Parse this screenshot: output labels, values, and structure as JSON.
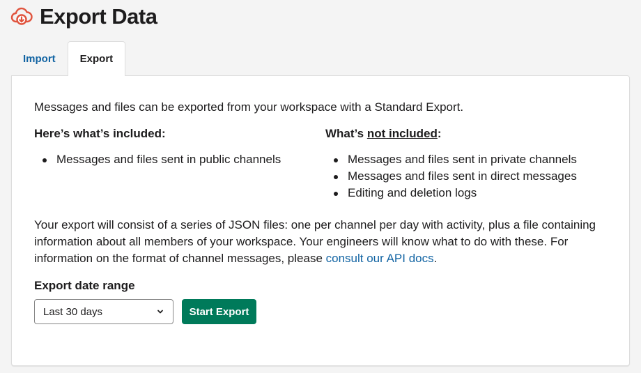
{
  "header": {
    "icon": "cloud-download-icon",
    "title": "Export Data",
    "icon_color": "#e0533d"
  },
  "tabs": [
    {
      "label": "Import",
      "active": false
    },
    {
      "label": "Export",
      "active": true
    }
  ],
  "panel": {
    "intro": "Messages and files can be exported from your workspace with a Standard Export.",
    "included": {
      "heading": "Here’s what’s included:",
      "items": [
        "Messages and files sent in public channels"
      ]
    },
    "not_included": {
      "heading_prefix": "What’s ",
      "heading_underlined": "not included",
      "heading_suffix": ":",
      "items": [
        "Messages and files sent in private channels",
        "Messages and files sent in direct messages",
        "Editing and deletion logs"
      ]
    },
    "description": "Your export will consist of a series of JSON files: one per channel per day with activity, plus a file containing information about all members of your workspace. Your engineers will know what to do with these. For information on the format of channel messages, please ",
    "description_link": "consult our API docs",
    "description_end": ".",
    "range_label": "Export date range",
    "range_select": {
      "value": "Last 30 days",
      "icon": "chevron-down-icon"
    },
    "start_button": "Start Export",
    "accent_color": "#007a5a",
    "link_color": "#1264a3"
  }
}
